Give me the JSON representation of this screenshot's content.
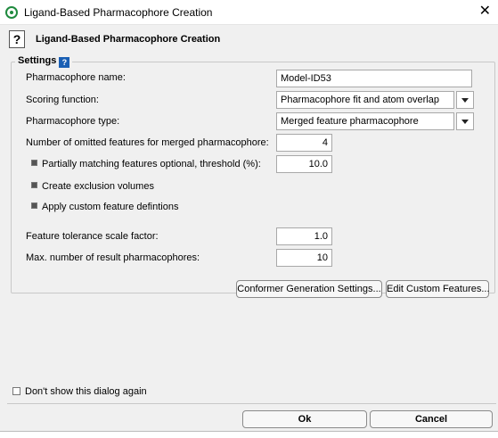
{
  "window": {
    "title": "Ligand-Based Pharmacophore Creation",
    "close_glyph": "✕"
  },
  "header": {
    "help_glyph": "?",
    "title": "Ligand-Based Pharmacophore Creation"
  },
  "settings": {
    "legend": "Settings",
    "help_glyph": "?",
    "pharmacophore_name": {
      "label": "Pharmacophore name:",
      "value": "Model-ID53"
    },
    "scoring_function": {
      "label": "Scoring function:",
      "value": "Pharmacophore fit and atom overlap"
    },
    "pharmacophore_type": {
      "label": "Pharmacophore type:",
      "value": "Merged feature pharmacophore"
    },
    "omitted_features": {
      "label": "Number of omitted features for merged pharmacophore:",
      "value": "4"
    },
    "partial_matching": {
      "label": "Partially matching features optional, threshold (%):",
      "value": "10.0",
      "checked": true
    },
    "exclusion_volumes": {
      "label": "Create exclusion volumes",
      "checked": true
    },
    "custom_features": {
      "label": "Apply custom feature defintions",
      "checked": true
    },
    "tolerance": {
      "label": "Feature tolerance scale factor:",
      "value": "1.0"
    },
    "max_results": {
      "label": "Max. number of result pharmacophores:",
      "value": "10"
    }
  },
  "buttons": {
    "conformer": "Conformer Generation Settings...",
    "custom_features": "Edit Custom Features...",
    "ok": "Ok",
    "cancel": "Cancel"
  },
  "dont_show": {
    "label": "Don't show this dialog again",
    "checked": false
  },
  "colors": {
    "accent_help": "#1a5fb4",
    "app_icon": "#1f8a3e",
    "dialog_bg": "#f0f0f0"
  }
}
